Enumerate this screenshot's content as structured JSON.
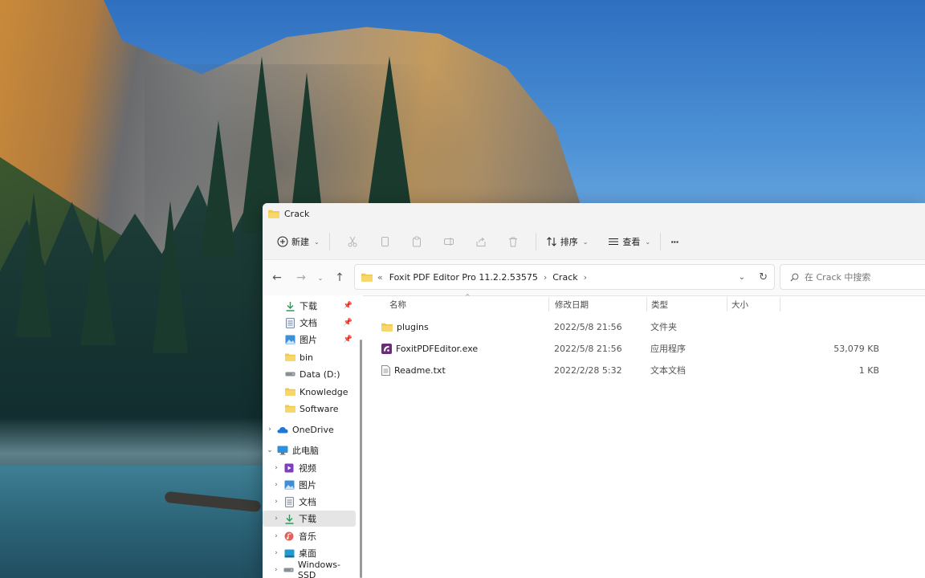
{
  "window": {
    "title": "Crack"
  },
  "toolbar": {
    "new_label": "新建",
    "sort_label": "排序",
    "view_label": "查看",
    "more_label": "···"
  },
  "address": {
    "overflow": "«",
    "path": [
      "Foxit PDF Editor Pro 11.2.2.53575",
      "Crack"
    ],
    "separator": "›"
  },
  "search": {
    "placeholder": "在 Crack 中搜索"
  },
  "columns": {
    "name": "名称",
    "date": "修改日期",
    "type": "类型",
    "size": "大小"
  },
  "files": [
    {
      "name": "plugins",
      "date": "2022/5/8 21:56",
      "type": "文件夹",
      "size": "",
      "icon": "folder-icon"
    },
    {
      "name": "FoxitPDFEditor.exe",
      "date": "2022/5/8 21:56",
      "type": "应用程序",
      "size": "53,079 KB",
      "icon": "foxit-app-icon"
    },
    {
      "name": "Readme.txt",
      "date": "2022/2/28 5:32",
      "type": "文本文档",
      "size": "1 KB",
      "icon": "text-file-icon"
    }
  ],
  "nav": {
    "quick_access": [
      {
        "label": "下载",
        "icon": "download-icon",
        "pinned": true
      },
      {
        "label": "文档",
        "icon": "document-icon",
        "pinned": true
      },
      {
        "label": "图片",
        "icon": "pictures-icon",
        "pinned": true
      },
      {
        "label": "bin",
        "icon": "folder-icon",
        "pinned": false
      },
      {
        "label": "Data (D:)",
        "icon": "drive-icon",
        "pinned": false
      },
      {
        "label": "Knowledge",
        "icon": "folder-icon",
        "pinned": false
      },
      {
        "label": "Software",
        "icon": "folder-icon",
        "pinned": false
      }
    ],
    "onedrive": "OneDrive",
    "this_pc": "此电脑",
    "pc_items": [
      {
        "label": "视频",
        "icon": "videos-icon"
      },
      {
        "label": "图片",
        "icon": "pictures-icon"
      },
      {
        "label": "文档",
        "icon": "document-icon"
      },
      {
        "label": "下载",
        "icon": "download-icon",
        "selected": true
      },
      {
        "label": "音乐",
        "icon": "music-icon"
      },
      {
        "label": "桌面",
        "icon": "desktop-icon"
      },
      {
        "label": "Windows-SSD",
        "icon": "drive-icon"
      }
    ]
  },
  "colors": {
    "accent": "#0067c0",
    "folder": "#f2c94c",
    "selection": "#e5e5e5",
    "window_bg": "#ffffff",
    "chrome_bg": "#f3f3f3"
  }
}
